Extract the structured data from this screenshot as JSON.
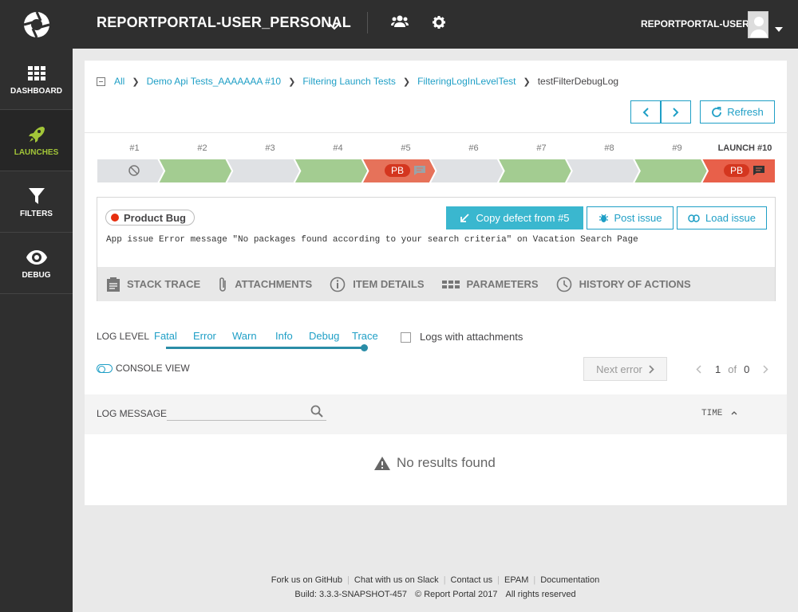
{
  "sidebar": {
    "items": [
      {
        "label": "DASHBOARD",
        "icon": "grid-icon"
      },
      {
        "label": "LAUNCHES",
        "icon": "rocket-icon"
      },
      {
        "label": "FILTERS",
        "icon": "funnel-icon"
      },
      {
        "label": "DEBUG",
        "icon": "eye-icon"
      }
    ],
    "active_color": "#a2c538"
  },
  "header": {
    "project": "REPORTPORTAL-USER_PERSONAL",
    "username": "REPORTPORTAL-USER"
  },
  "breadcrumb": {
    "items": [
      "All",
      "Demo Api Tests_AAAAAAA #10",
      "Filtering Launch Tests",
      "FilteringLogInLevelTest"
    ],
    "current": "testFilterDebugLog"
  },
  "toolbar": {
    "refresh_label": "Refresh"
  },
  "history": {
    "labels": [
      "#1",
      "#2",
      "#3",
      "#4",
      "#5",
      "#6",
      "#7",
      "#8",
      "#9",
      "LAUNCH #10"
    ],
    "statuses": [
      "skipped",
      "passed",
      "no-item",
      "passed",
      "failed",
      "no-item",
      "passed",
      "no-item",
      "passed",
      "failed"
    ],
    "defect_badge": "PB"
  },
  "defect": {
    "type_label": "Product Bug",
    "copy_label": "Copy defect from #5",
    "post_issue_label": "Post issue",
    "load_issue_label": "Load issue",
    "description": "App issue Error message \"No packages found according to your search criteria\" on Vacation Search Page",
    "tabs": [
      "STACK TRACE",
      "ATTACHMENTS",
      "ITEM DETAILS",
      "PARAMETERS",
      "HISTORY OF ACTIONS"
    ]
  },
  "log_filter": {
    "log_level_label": "LOG LEVEL",
    "levels": [
      "Fatal",
      "Error",
      "Warn",
      "Info",
      "Debug",
      "Trace"
    ],
    "selected_level": "Trace",
    "attachments_label": "Logs with attachments",
    "console_view_label": "CONSOLE VIEW",
    "next_error_label": "Next error",
    "page_current": "1",
    "page_of": "of",
    "page_total": "0"
  },
  "log_table": {
    "message_header": "LOG MESSAGE",
    "search_placeholder": "",
    "time_header": "TIME",
    "empty_text": "No results found"
  },
  "footer": {
    "links": [
      "Fork us on GitHub",
      "Chat with us on Slack",
      "Contact us",
      "EPAM",
      "Documentation"
    ],
    "build": "Build: 3.3.3-SNAPSHOT-457",
    "copyright": "© Report Portal 2017",
    "rights": "All rights reserved"
  },
  "colors": {
    "passed": "#a3cc91",
    "failed": "#e6725a",
    "no_item": "#dfe1e4",
    "accent": "#1f9fc6",
    "product_bug": "#e62e0e"
  }
}
